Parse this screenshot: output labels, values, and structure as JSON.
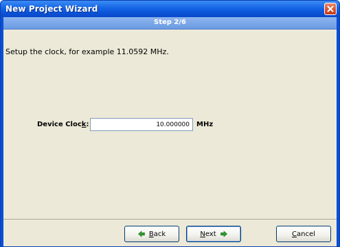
{
  "window": {
    "title": "New Project Wizard"
  },
  "header": {
    "step": "Step 2/6"
  },
  "main": {
    "instruction": "Setup the clock, for example 11.0592 MHz.",
    "clock_label_prefix": "Device Cloc",
    "clock_label_mnemonic": "k",
    "clock_label_suffix": ":",
    "clock_value": "10.000000",
    "clock_unit": "MHz"
  },
  "footer": {
    "back_mnemonic": "B",
    "back_rest": "ack",
    "next_mnemonic": "N",
    "next_rest": "ext",
    "cancel_mnemonic": "C",
    "cancel_rest": "ancel"
  },
  "colors": {
    "titlebar": "#0c54d8",
    "step_bar": "#7aa7e8",
    "panel": "#ece9d8",
    "arrow_green": "#2e9b2e",
    "close_red": "#d9532f"
  }
}
